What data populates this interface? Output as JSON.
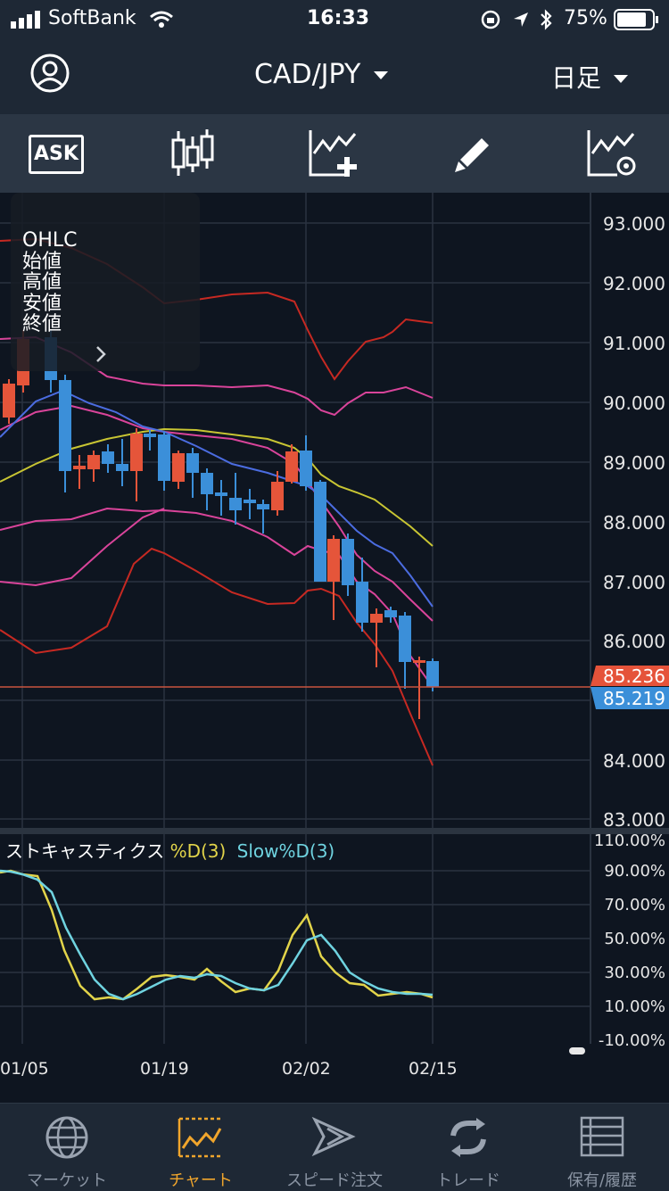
{
  "status": {
    "carrier": "SoftBank",
    "time": "16:33",
    "battery": "75%"
  },
  "nav": {
    "pair": "CAD/JPY",
    "timeframe": "日足"
  },
  "toolbar": {
    "ask_label": "ASK"
  },
  "ohlc_panel": {
    "title": "OHLC",
    "open_label": "始値",
    "high_label": "高値",
    "low_label": "安値",
    "close_label": "終値"
  },
  "price_axis": [
    "93.000",
    "92.000",
    "91.000",
    "90.000",
    "89.000",
    "88.000",
    "87.000",
    "86.000",
    "84.000",
    "83.000"
  ],
  "current_prices": {
    "ask": "85.236",
    "bid": "85.219",
    "ask_color": "#e5533a",
    "bid_color": "#3b8fd9"
  },
  "oscillator": {
    "name": "ストキャスティクス",
    "d_label": "%D(3)",
    "slow_label": "Slow%D(3)",
    "d_color": "#e2d44a",
    "slow_color": "#6fd3e0",
    "axis": [
      "110.00%",
      "90.00%",
      "70.00%",
      "50.00%",
      "30.00%",
      "10.00%",
      "-10.00%"
    ]
  },
  "dates": [
    "01/05",
    "01/19",
    "02/02",
    "02/15"
  ],
  "tabs": [
    {
      "label": "マーケット",
      "icon": "globe-icon"
    },
    {
      "label": "チャート",
      "icon": "chart-icon"
    },
    {
      "label": "スピード注文",
      "icon": "speed-order-icon"
    },
    {
      "label": "トレード",
      "icon": "trade-refresh-icon"
    },
    {
      "label": "保有/履歴",
      "icon": "list-icon"
    }
  ],
  "colors": {
    "up_candle": "#e5553a",
    "down_candle": "#3b8fd9",
    "bollinger_outer": "#d8281f",
    "bollinger_inner": "#e0479b",
    "ma_long": "#c8c533",
    "ma_short": "#4b6ce0",
    "active_tab": "#f0a52c"
  }
}
